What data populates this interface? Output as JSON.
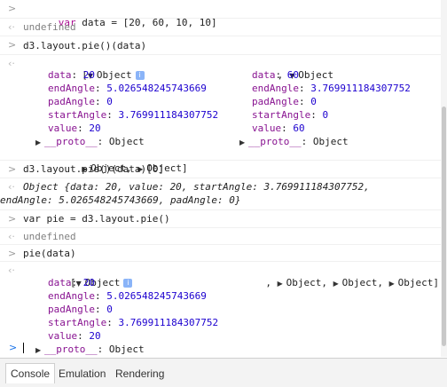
{
  "entries": [
    {
      "type": "input",
      "code": "var data = [20, 60, 10, 10]"
    },
    {
      "type": "output",
      "text": "undefined"
    },
    {
      "type": "input",
      "code": "d3.layout.pie()(data)"
    },
    {
      "type": "output-array",
      "open": "[",
      "obj1": {
        "label": "Object",
        "props": [
          {
            "k": "data",
            "v": "20"
          },
          {
            "k": "endAngle",
            "v": "5.026548245743669"
          },
          {
            "k": "padAngle",
            "v": "0"
          },
          {
            "k": "startAngle",
            "v": "3.769911184307752"
          },
          {
            "k": "value",
            "v": "20"
          }
        ],
        "proto": "__proto__",
        "proto_val": "Object"
      },
      "obj2": {
        "label": "Object",
        "props": [
          {
            "k": "data",
            "v": "60"
          },
          {
            "k": "endAngle",
            "v": "3.769911184307752"
          },
          {
            "k": "padAngle",
            "v": "0"
          },
          {
            "k": "startAngle",
            "v": "0"
          },
          {
            "k": "value",
            "v": "60"
          }
        ],
        "proto": "__proto__",
        "proto_val": "Object"
      },
      "tail1": "Object,",
      "tail2": "Object]"
    },
    {
      "type": "input",
      "code": "d3.layout.pie()(data)[0]"
    },
    {
      "type": "output-inline",
      "line1": "Object {data: 20, value: 20, startAngle: 3.769911184307752,",
      "line2": "endAngle: 5.026548245743669, padAngle: 0}"
    },
    {
      "type": "input",
      "code": "var pie = d3.layout.pie()"
    },
    {
      "type": "output",
      "text": "undefined"
    },
    {
      "type": "input",
      "code": "pie(data)"
    },
    {
      "type": "output-array2",
      "open": "[",
      "obj1": {
        "label": "Object",
        "props": [
          {
            "k": "data",
            "v": "20"
          },
          {
            "k": "endAngle",
            "v": "5.026548245743669"
          },
          {
            "k": "padAngle",
            "v": "0"
          },
          {
            "k": "startAngle",
            "v": "3.769911184307752"
          },
          {
            "k": "value",
            "v": "20"
          }
        ],
        "proto": "__proto__",
        "proto_val": "Object"
      },
      "collapsed1": "Object,",
      "collapsed2": "Object,",
      "collapsed3": "Object]"
    }
  ],
  "drawer": {
    "tabs": [
      "Console",
      "Emulation",
      "Rendering"
    ],
    "active": "Console"
  }
}
